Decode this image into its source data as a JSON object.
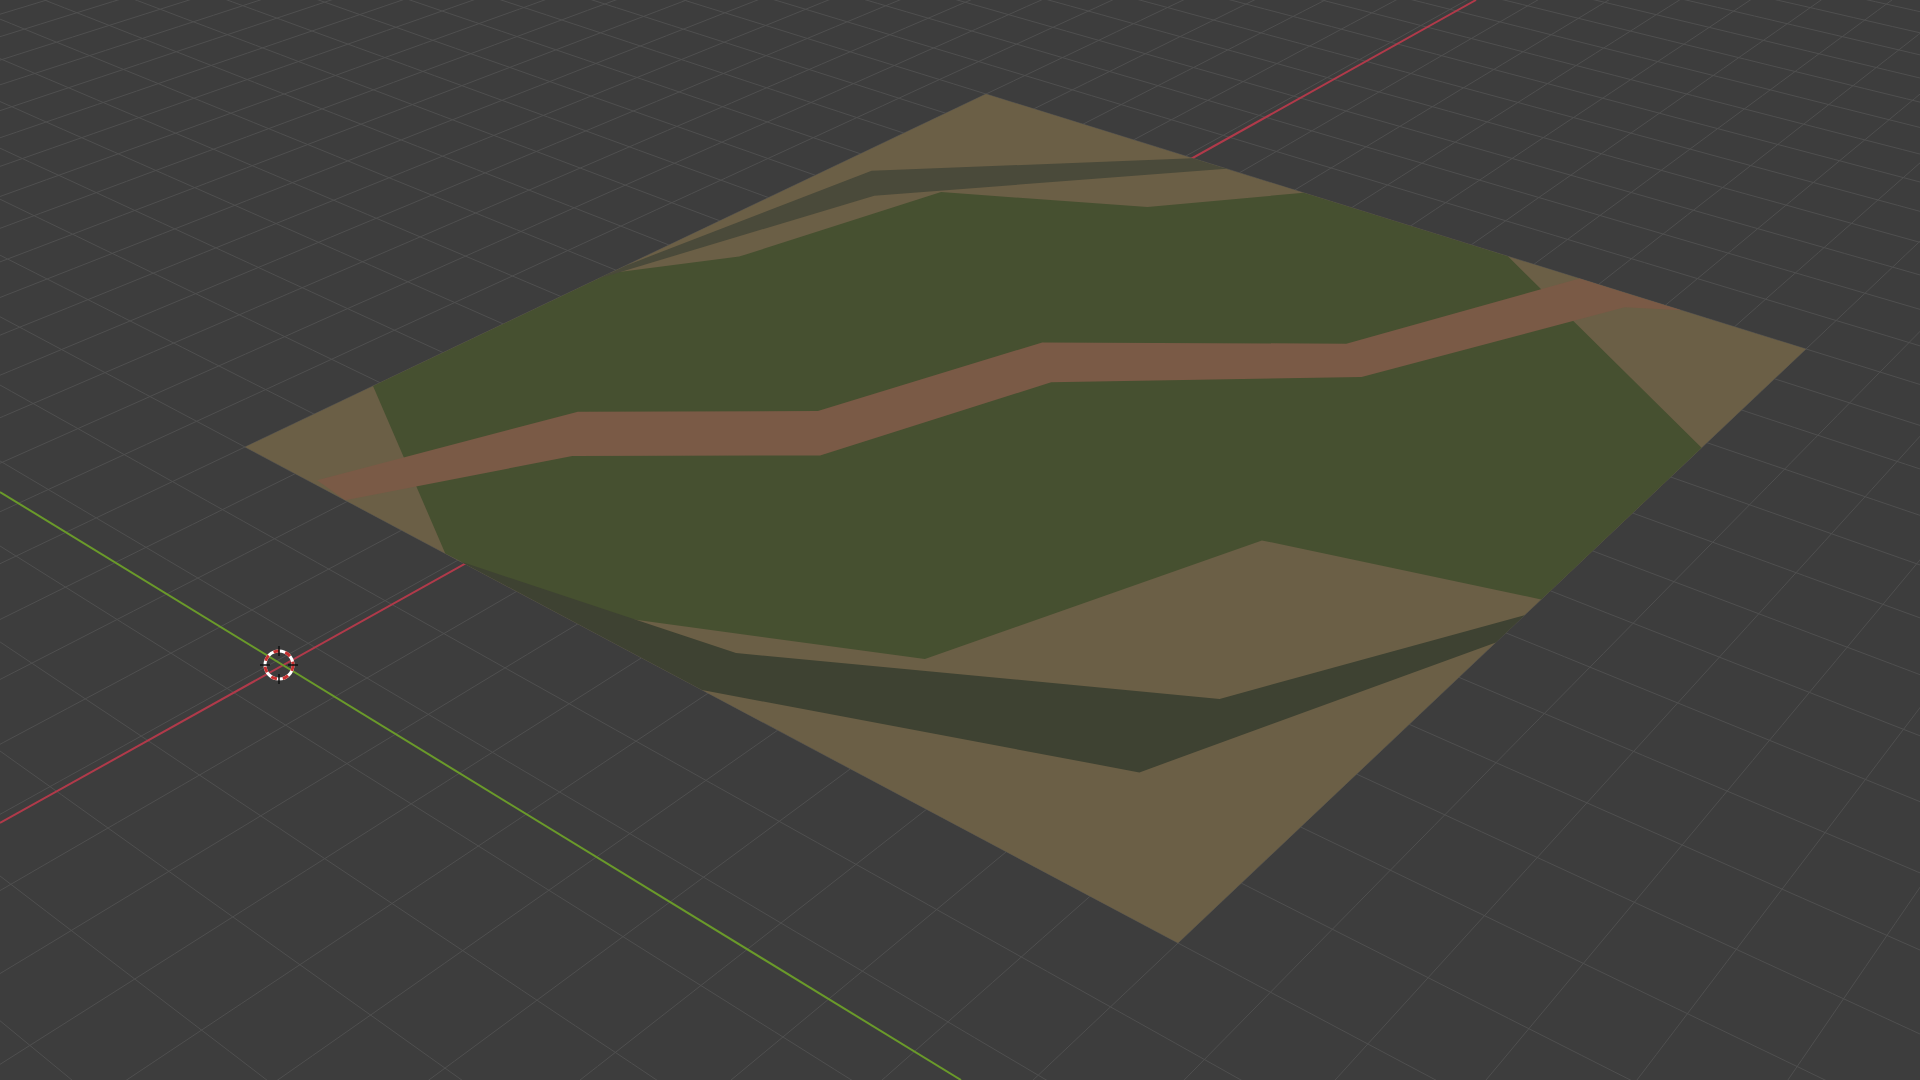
{
  "viewport": {
    "kind": "perspective",
    "objects": [
      {
        "kind": "terrain"
      }
    ]
  }
}
